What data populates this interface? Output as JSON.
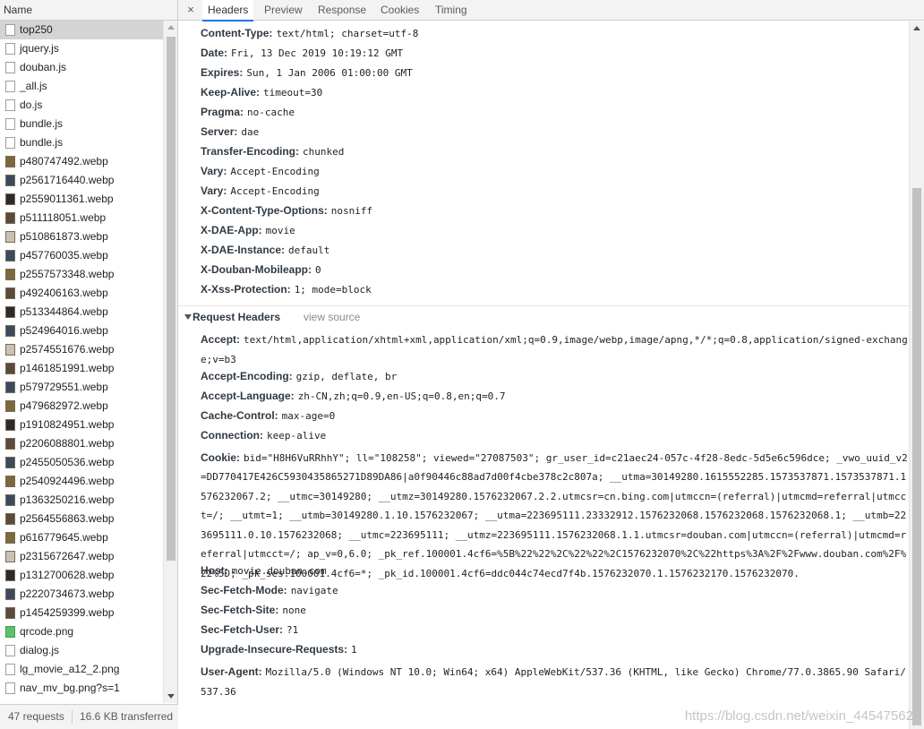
{
  "left": {
    "column_header": "Name",
    "files": [
      {
        "name": "top250",
        "icon": "document-icon",
        "selected": true
      },
      {
        "name": "jquery.js",
        "icon": "document-icon"
      },
      {
        "name": "douban.js",
        "icon": "document-icon"
      },
      {
        "name": "_all.js",
        "icon": "document-icon"
      },
      {
        "name": "do.js",
        "icon": "document-icon"
      },
      {
        "name": "bundle.js",
        "icon": "document-icon"
      },
      {
        "name": "bundle.js",
        "icon": "document-icon"
      },
      {
        "name": "p480747492.webp",
        "icon": "image-thumbnail-icon"
      },
      {
        "name": "p2561716440.webp",
        "icon": "image-thumbnail-icon"
      },
      {
        "name": "p2559011361.webp",
        "icon": "image-thumbnail-icon"
      },
      {
        "name": "p511118051.webp",
        "icon": "image-thumbnail-icon"
      },
      {
        "name": "p510861873.webp",
        "icon": "image-thumbnail-icon"
      },
      {
        "name": "p457760035.webp",
        "icon": "image-thumbnail-icon"
      },
      {
        "name": "p2557573348.webp",
        "icon": "image-thumbnail-icon"
      },
      {
        "name": "p492406163.webp",
        "icon": "image-thumbnail-icon"
      },
      {
        "name": "p513344864.webp",
        "icon": "image-thumbnail-icon"
      },
      {
        "name": "p524964016.webp",
        "icon": "image-thumbnail-icon"
      },
      {
        "name": "p2574551676.webp",
        "icon": "image-thumbnail-icon"
      },
      {
        "name": "p1461851991.webp",
        "icon": "image-thumbnail-icon"
      },
      {
        "name": "p579729551.webp",
        "icon": "image-thumbnail-icon"
      },
      {
        "name": "p479682972.webp",
        "icon": "image-thumbnail-icon"
      },
      {
        "name": "p1910824951.webp",
        "icon": "image-thumbnail-icon"
      },
      {
        "name": "p2206088801.webp",
        "icon": "image-thumbnail-icon"
      },
      {
        "name": "p2455050536.webp",
        "icon": "image-thumbnail-icon"
      },
      {
        "name": "p2540924496.webp",
        "icon": "image-thumbnail-icon"
      },
      {
        "name": "p1363250216.webp",
        "icon": "image-thumbnail-icon"
      },
      {
        "name": "p2564556863.webp",
        "icon": "image-thumbnail-icon"
      },
      {
        "name": "p616779645.webp",
        "icon": "image-thumbnail-icon"
      },
      {
        "name": "p2315672647.webp",
        "icon": "image-thumbnail-icon"
      },
      {
        "name": "p1312700628.webp",
        "icon": "image-thumbnail-icon"
      },
      {
        "name": "p2220734673.webp",
        "icon": "image-thumbnail-icon"
      },
      {
        "name": "p1454259399.webp",
        "icon": "image-thumbnail-icon"
      },
      {
        "name": "qrcode.png",
        "icon": "png-image-icon"
      },
      {
        "name": "dialog.js",
        "icon": "document-icon"
      },
      {
        "name": "lg_movie_a12_2.png",
        "icon": "document-icon"
      },
      {
        "name": "nav_mv_bg.png?s=1",
        "icon": "document-icon"
      }
    ],
    "status": {
      "requests": "47 requests",
      "transferred": "16.6 KB transferred"
    }
  },
  "tabs": {
    "close_icon": "×",
    "items": [
      {
        "label": "Headers",
        "active": true
      },
      {
        "label": "Preview"
      },
      {
        "label": "Response"
      },
      {
        "label": "Cookies"
      },
      {
        "label": "Timing"
      }
    ]
  },
  "response_headers": [
    {
      "key": "Content-Type:",
      "value": "text/html; charset=utf-8"
    },
    {
      "key": "Date:",
      "value": "Fri, 13 Dec 2019 10:19:12 GMT"
    },
    {
      "key": "Expires:",
      "value": "Sun, 1 Jan 2006 01:00:00 GMT"
    },
    {
      "key": "Keep-Alive:",
      "value": "timeout=30"
    },
    {
      "key": "Pragma:",
      "value": "no-cache"
    },
    {
      "key": "Server:",
      "value": "dae"
    },
    {
      "key": "Transfer-Encoding:",
      "value": "chunked"
    },
    {
      "key": "Vary:",
      "value": "Accept-Encoding"
    },
    {
      "key": "Vary:",
      "value": "Accept-Encoding"
    },
    {
      "key": "X-Content-Type-Options:",
      "value": "nosniff"
    },
    {
      "key": "X-DAE-App:",
      "value": "movie"
    },
    {
      "key": "X-DAE-Instance:",
      "value": "default"
    },
    {
      "key": "X-Douban-Mobileapp:",
      "value": "0"
    },
    {
      "key": "X-Xss-Protection:",
      "value": "1; mode=block"
    }
  ],
  "request_section": {
    "title": "Request Headers",
    "view_source": "view source"
  },
  "request_headers": [
    {
      "key": "Accept:",
      "value": "text/html,application/xhtml+xml,application/xml;q=0.9,image/webp,image/apng,*/*;q=0.8,application/signed-exchange;v=b3",
      "lines": 2
    },
    {
      "key": "Accept-Encoding:",
      "value": "gzip, deflate, br",
      "lines": 1
    },
    {
      "key": "Accept-Language:",
      "value": "zh-CN,zh;q=0.9,en-US;q=0.8,en;q=0.7",
      "lines": 1
    },
    {
      "key": "Cache-Control:",
      "value": "max-age=0",
      "lines": 1
    },
    {
      "key": "Connection:",
      "value": "keep-alive",
      "lines": 1
    },
    {
      "key": "Cookie:",
      "value": "bid=\"H8H6VuRRhhY\"; ll=\"108258\"; viewed=\"27087503\"; gr_user_id=c21aec24-057c-4f28-8edc-5d5e6c596dce; _vwo_uuid_v2=DD770417E426C5930435865271D89DA86|a0f90446c88ad7d00f4cbe378c2c807a; __utma=30149280.1615552285.1573537871.1573537871.1576232067.2; __utmc=30149280; __utmz=30149280.1576232067.2.2.utmcsr=cn.bing.com|utmccn=(referral)|utmcmd=referral|utmcct=/; __utmt=1; __utmb=30149280.1.10.1576232067; __utma=223695111.23332912.1576232068.1576232068.1576232068.1; __utmb=223695111.0.10.1576232068; __utmc=223695111; __utmz=223695111.1576232068.1.1.utmcsr=douban.com|utmccn=(referral)|utmcmd=referral|utmcct=/; ap_v=0,6.0; _pk_ref.100001.4cf6=%5B%22%22%2C%22%22%2C1576232070%2C%22https%3A%2F%2Fwww.douban.com%2F%22%5D; _pk_ses.100001.4cf6=*; _pk_id.100001.4cf6=ddc044c74ecd7f4b.1576232070.1.1576232170.1576232070.",
      "lines": 6
    },
    {
      "key": "Host:",
      "value": "movie.douban.com",
      "lines": 1
    },
    {
      "key": "Sec-Fetch-Mode:",
      "value": "navigate",
      "lines": 1
    },
    {
      "key": "Sec-Fetch-Site:",
      "value": "none",
      "lines": 1
    },
    {
      "key": "Sec-Fetch-User:",
      "value": "?1",
      "lines": 1
    },
    {
      "key": "Upgrade-Insecure-Requests:",
      "value": "1",
      "lines": 1
    },
    {
      "key": "User-Agent:",
      "value": "Mozilla/5.0 (Windows NT 10.0; Win64; x64) AppleWebKit/537.36 (KHTML, like Gecko) Chrome/77.0.3865.90 Safari/537.36",
      "lines": 2
    }
  ],
  "watermark": "https://blog.csdn.net/weixin_44547562",
  "colors": {
    "accent": "#1a73e8",
    "selected_row": "#d4d4d4",
    "panel_bg": "#f3f3f3"
  }
}
